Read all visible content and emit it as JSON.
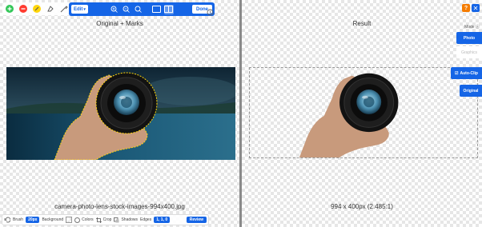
{
  "left_pane": {
    "title": "Original + Marks",
    "filename": "camera-photo-lens-stock-images-994x400.jpg"
  },
  "toolbar": {
    "edit_label": "Edit",
    "done_label": "Done"
  },
  "bottom_bar": {
    "brush_label": "Brush",
    "brush_value": "20px",
    "background_label": "Background",
    "colors_label": "Colors",
    "crop_label": "Crop",
    "shadows_label": "Shadows",
    "edges_label": "Edges",
    "edges_value": "1, 1, 0",
    "review_label": "Review"
  },
  "right_pane": {
    "title": "Result",
    "dimensions": "994 x 400px (2.485:1)",
    "help_label": "?",
    "close_label": "✕",
    "mode_label": "Mode",
    "mode_options": [
      "Photo",
      "Graphics"
    ],
    "auto_clip_label": "Auto-Clip",
    "original_label": "Original"
  },
  "colors": {
    "accent": "#1565e6",
    "help": "#f57c00",
    "mark_green": "#34c759",
    "mark_red": "#ff3b30",
    "mark_yellow": "#ffd60a"
  }
}
